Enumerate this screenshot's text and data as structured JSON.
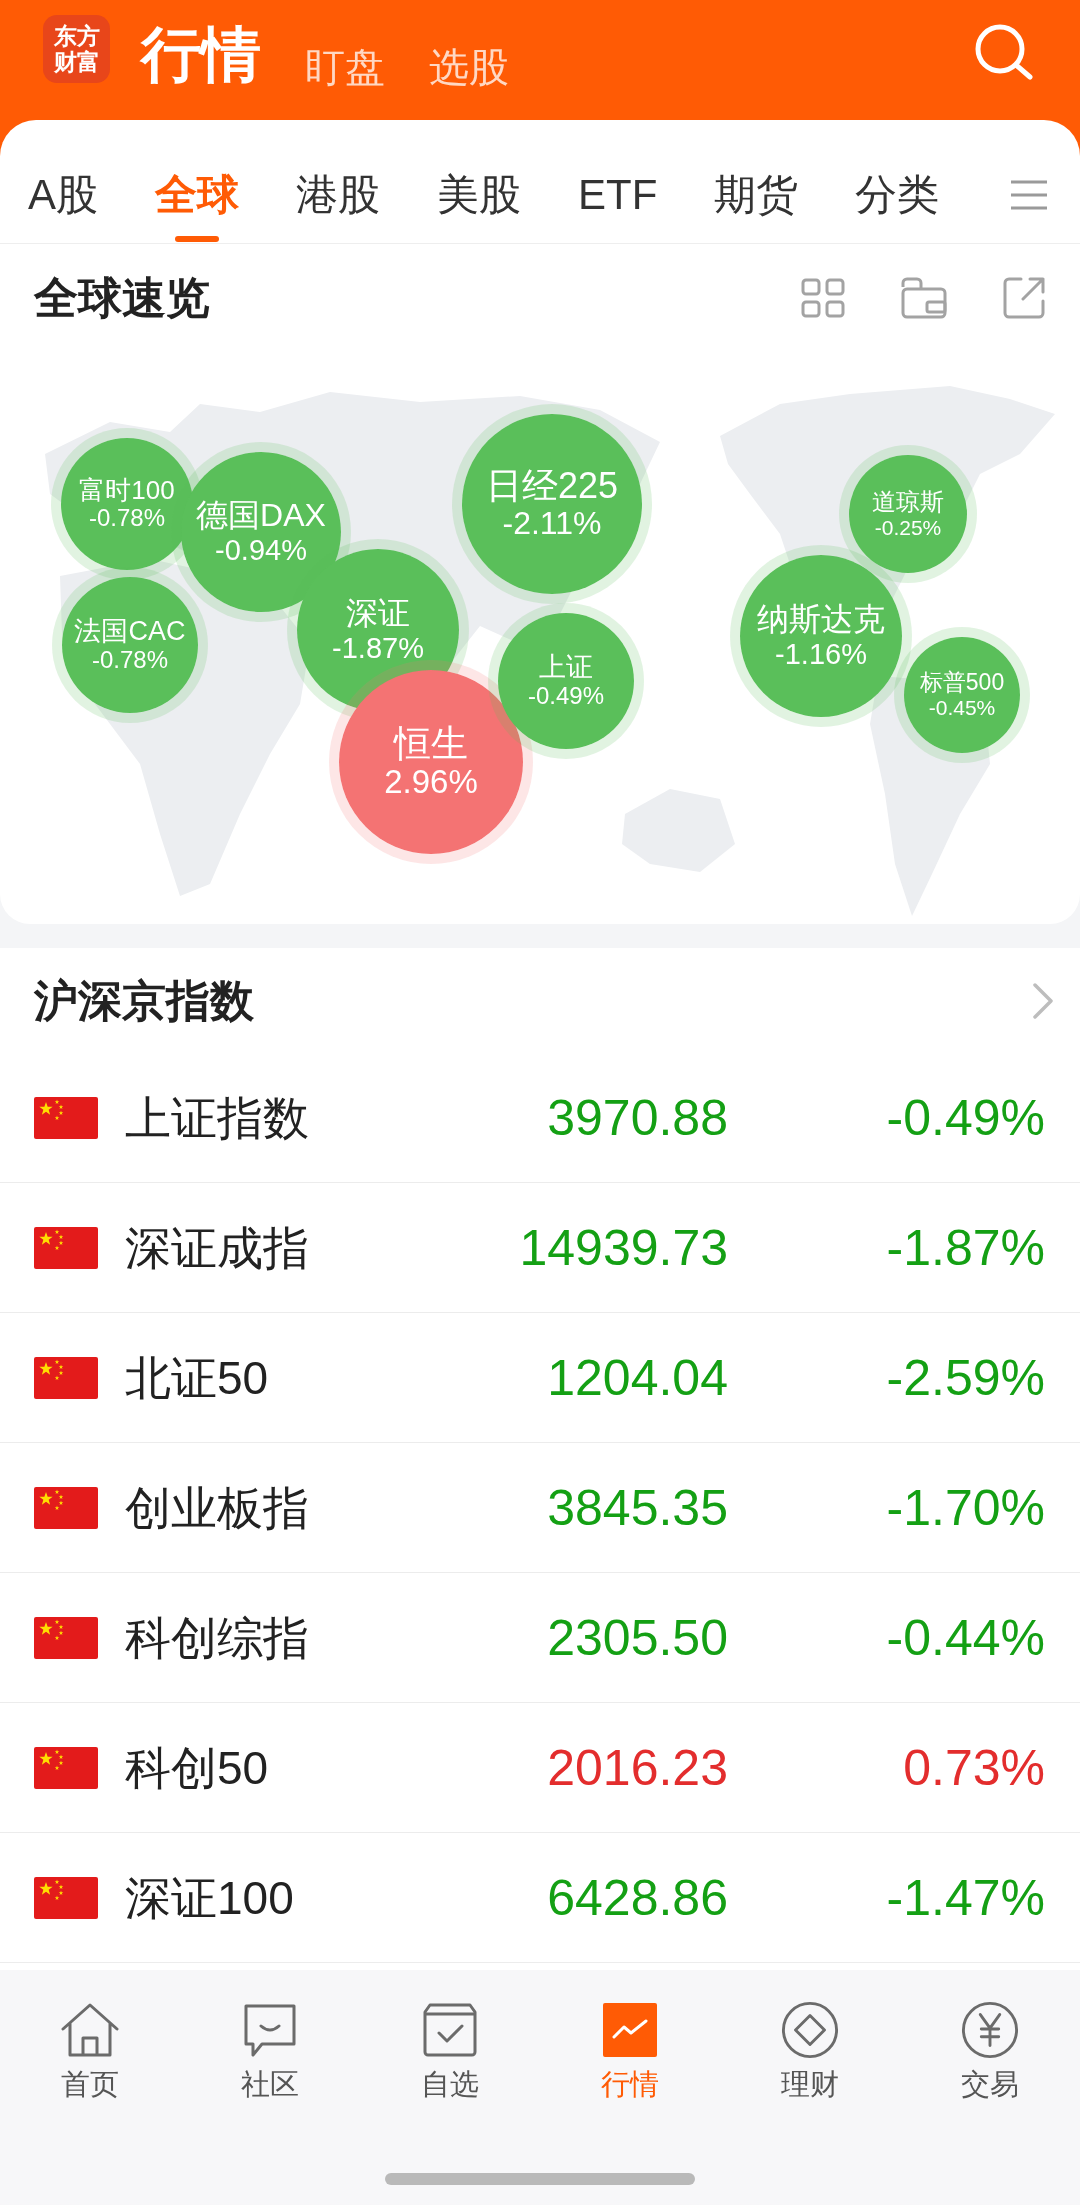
{
  "header": {
    "logo": "东方财富",
    "tabs": [
      {
        "label": "行情",
        "selected": true
      },
      {
        "label": "盯盘",
        "selected": false
      },
      {
        "label": "选股",
        "selected": false
      }
    ]
  },
  "market_tabs": [
    {
      "label": "A股",
      "selected": false
    },
    {
      "label": "全球",
      "selected": true
    },
    {
      "label": "港股",
      "selected": false
    },
    {
      "label": "美股",
      "selected": false
    },
    {
      "label": "ETF",
      "selected": false
    },
    {
      "label": "期货",
      "selected": false
    },
    {
      "label": "分类",
      "selected": false
    }
  ],
  "global_overview": {
    "title": "全球速览",
    "bubbles": [
      {
        "name": "富时100",
        "change": "-0.78%",
        "color": "#5abf5a"
      },
      {
        "name": "德国DAX",
        "change": "-0.94%",
        "color": "#5abf5a"
      },
      {
        "name": "法国CAC",
        "change": "-0.78%",
        "color": "#5abf5a"
      },
      {
        "name": "深证",
        "change": "-1.87%",
        "color": "#5abf5a"
      },
      {
        "name": "恒生",
        "change": "2.96%",
        "color": "#f47373"
      },
      {
        "name": "日经225",
        "change": "-2.11%",
        "color": "#5abf5a"
      },
      {
        "name": "上证",
        "change": "-0.49%",
        "color": "#5abf5a"
      },
      {
        "name": "纳斯达克",
        "change": "-1.16%",
        "color": "#5abf5a"
      },
      {
        "name": "道琼斯",
        "change": "-0.25%",
        "color": "#5abf5a"
      },
      {
        "name": "标普500",
        "change": "-0.45%",
        "color": "#5abf5a"
      }
    ]
  },
  "index_list": {
    "title": "沪深京指数",
    "rows": [
      {
        "name": "上证指数",
        "value": "3970.88",
        "change": "-0.49%",
        "color": "#14a014"
      },
      {
        "name": "深证成指",
        "value": "14939.73",
        "change": "-1.87%",
        "color": "#14a014"
      },
      {
        "name": "北证50",
        "value": "1204.04",
        "change": "-2.59%",
        "color": "#14a014"
      },
      {
        "name": "创业板指",
        "value": "3845.35",
        "change": "-1.70%",
        "color": "#14a014"
      },
      {
        "name": "科创综指",
        "value": "2305.50",
        "change": "-0.44%",
        "color": "#14a014"
      },
      {
        "name": "科创50",
        "value": "2016.23",
        "change": "0.73%",
        "color": "#e32d2d"
      },
      {
        "name": "深证100",
        "value": "6428.86",
        "change": "-1.47%",
        "color": "#14a014"
      }
    ]
  },
  "bottom_nav": [
    {
      "label": "首页",
      "selected": false
    },
    {
      "label": "社区",
      "selected": false
    },
    {
      "label": "自选",
      "selected": false
    },
    {
      "label": "行情",
      "selected": true
    },
    {
      "label": "理财",
      "selected": false
    },
    {
      "label": "交易",
      "selected": false
    }
  ]
}
